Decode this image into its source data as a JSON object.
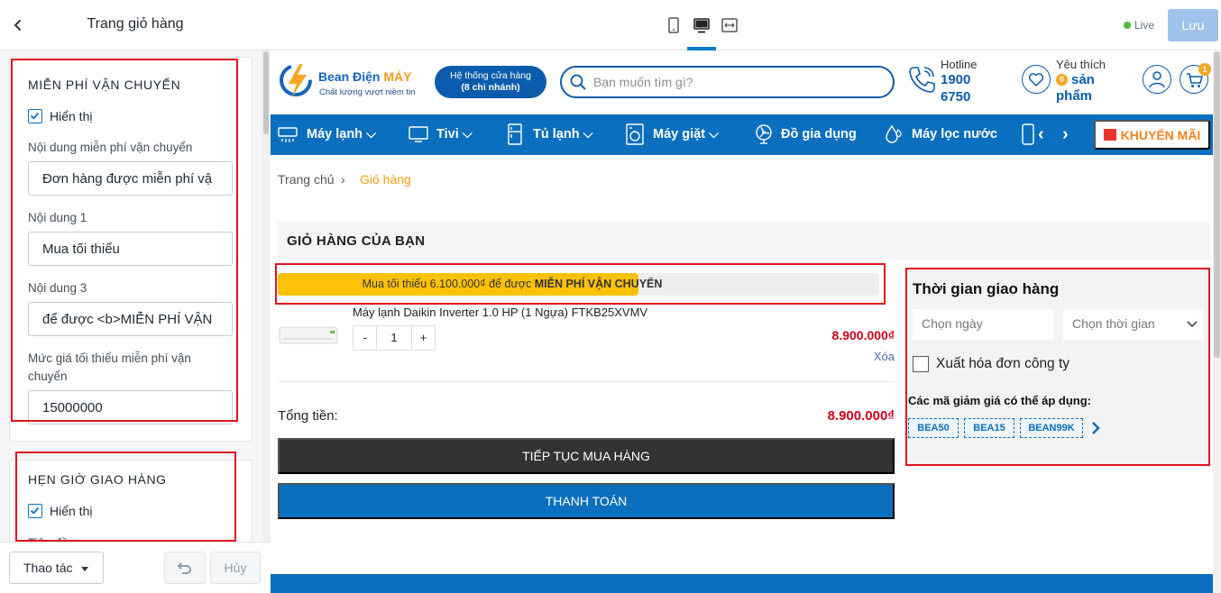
{
  "sidebar": {
    "title": "Trang giỏ hàng",
    "free_shipping": {
      "title": "MIỄN PHÍ VẬN CHUYỂN",
      "show_label": "Hiển thị",
      "content_label": "Nội dung miễn phí vận chuyển",
      "content_value": "Đơn hàng được miễn phí vậ",
      "content1_label": "Nội dung 1",
      "content1_value": "Mua tối thiểu",
      "content3_label": "Nội dung 3",
      "content3_value": "để được <b>MIỄN PHÍ VẬN",
      "min_price_label": "Mức giá tối thiểu miễn phí vận chuyển",
      "min_price_value": "15000000"
    },
    "delivery_schedule": {
      "title": "HẸN GIỜ GIAO HÀNG",
      "show_label": "Hiển thị",
      "partial_label": "Tiêu đề"
    },
    "footer": {
      "actions_label": "Thao tác",
      "cancel_label": "Hủy"
    }
  },
  "topbar": {
    "live_label": "Live",
    "save_label": "Lưu"
  },
  "store": {
    "logo_title_main": "Bean Điện ",
    "logo_title_accent": "MÁY",
    "logo_subtitle": "Chất lượng vượt niềm tin",
    "store_system_line1": "Hệ thống cửa hàng",
    "store_system_line2": "(8 chi nhánh)",
    "search_placeholder": "Bạn muốn tìm gì?",
    "hotline_label": "Hotline",
    "hotline_line1": "1900",
    "hotline_line2": "6750",
    "wishlist_label": "Yêu thích",
    "wishlist_count": "0",
    "wishlist_line1": "sản",
    "wishlist_line2": "phẩm",
    "cart_count": "1",
    "nav": [
      "Máy lạnh",
      "Tivi",
      "Tủ lạnh",
      "Máy giặt",
      "Đồ gia dụng",
      "Máy lọc nước"
    ],
    "promo_label": "KHUYẾN MÃI",
    "breadcrumb_home": "Trang chủ",
    "breadcrumb_sep": "›",
    "breadcrumb_current": "Giỏ hàng"
  },
  "cart": {
    "title": "GIỎ HÀNG CỦA BẠN",
    "shipping_progress": 0.6,
    "shipping_text_prefix": "Mua tối thiểu 6.100.000₫ để được ",
    "shipping_text_bold": "MIỄN PHÍ VẬN CHUYỂN",
    "product_name": "Máy lạnh Daikin Inverter 1.0 HP (1 Ngựa) FTKB25XVMV",
    "qty_minus": "-",
    "quantity": "1",
    "qty_plus": "+",
    "price": "8.900.000₫",
    "remove_label": "Xóa",
    "total_label": "Tổng tiền:",
    "total_value": "8.900.000₫",
    "continue_label": "TIẾP TỤC MUA HÀNG",
    "checkout_label": "THANH TOÁN"
  },
  "delivery": {
    "title": "Thời gian giao hàng",
    "date_placeholder": "Chọn ngày",
    "time_placeholder": "Chọn thời gian",
    "invoice_label": "Xuất hóa đơn công ty",
    "coupon_label": "Các mã giảm giá có thể áp dụng:",
    "coupons": [
      "BEA50",
      "BEA15",
      "BEAN99K"
    ]
  },
  "colors": {
    "brand_blue": "#0b6fbf",
    "accent_orange": "#f5821f",
    "price_red": "#d0021b",
    "highlight_red": "#e0141e"
  }
}
